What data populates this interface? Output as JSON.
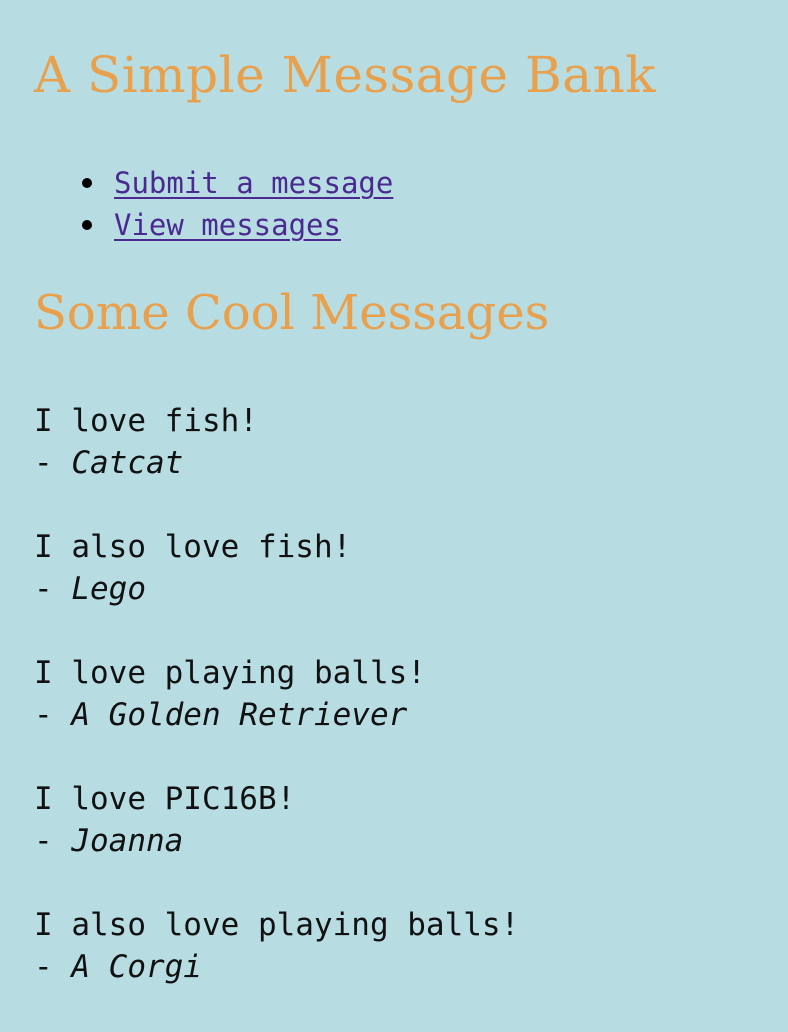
{
  "header": {
    "title": "A Simple Message Bank"
  },
  "nav": {
    "items": [
      {
        "label": "Submit a message"
      },
      {
        "label": "View messages"
      }
    ]
  },
  "section": {
    "title": "Some Cool Messages"
  },
  "messages": [
    {
      "text": "I love fish!",
      "dash": "- ",
      "author": "Catcat"
    },
    {
      "text": "I also love fish!",
      "dash": "- ",
      "author": "Lego"
    },
    {
      "text": "I love playing balls!",
      "dash": "- ",
      "author": "A Golden Retriever"
    },
    {
      "text": "I love PIC16B!",
      "dash": "- ",
      "author": "Joanna"
    },
    {
      "text": "I also love playing balls!",
      "dash": "- ",
      "author": "A Corgi"
    }
  ]
}
